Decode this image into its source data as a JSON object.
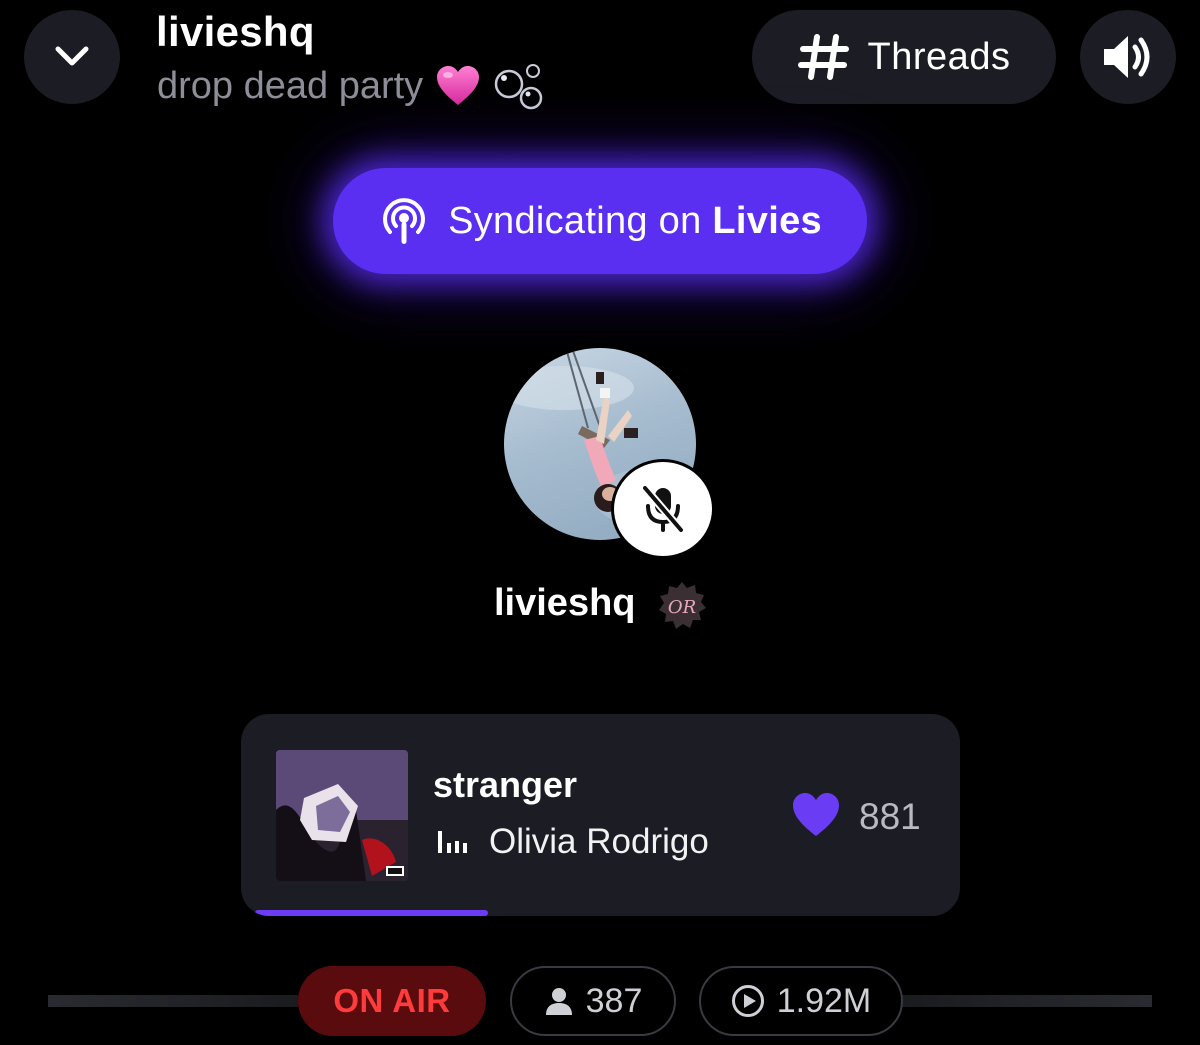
{
  "header": {
    "title": "livieshq",
    "subtitle": "drop dead party",
    "subtitle_emojis": [
      "pink-heart-emoji",
      "bubbles-emoji"
    ],
    "threads_label": "Threads"
  },
  "syndication": {
    "prefix": "Syndicating on ",
    "platform": "Livies",
    "accent_color": "#5a2ff2"
  },
  "host": {
    "name": "livieshq",
    "mic_state": "muted",
    "badge_text": "OR"
  },
  "now_playing": {
    "title": "stranger",
    "artist": "Olivia Rodrigo",
    "likes": "881",
    "progress": 0.33,
    "like_color": "#6a3df5"
  },
  "status": {
    "on_air_label": "ON AIR",
    "listeners": "387",
    "plays": "1.92M",
    "on_air_color": "#ff3b3b"
  }
}
